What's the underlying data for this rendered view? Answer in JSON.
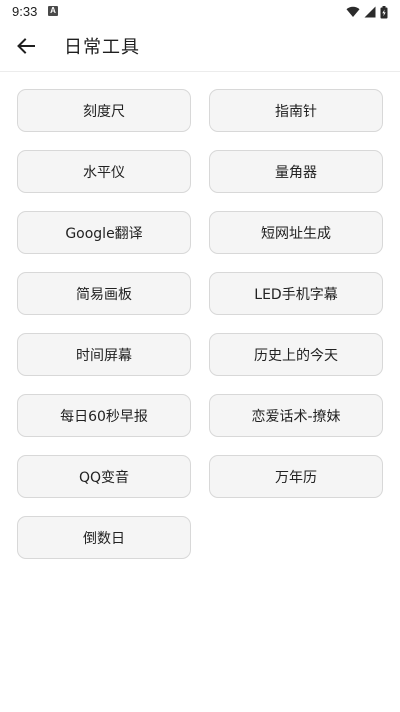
{
  "status_bar": {
    "time": "9:33",
    "notification_icon": "a-icon",
    "right_icons": [
      "wifi-icon",
      "signal-icon",
      "battery-icon"
    ]
  },
  "app_bar": {
    "back_icon": "arrow-left-icon",
    "title": "日常工具"
  },
  "tools": [
    "刻度尺",
    "指南针",
    "水平仪",
    "量角器",
    "Google翻译",
    "短网址生成",
    "简易画板",
    "LED手机字幕",
    "时间屏幕",
    "历史上的今天",
    "每日60秒早报",
    "恋爱话术-撩妹",
    "QQ变音",
    "万年历",
    "倒数日"
  ],
  "colors": {
    "button_bg": "#f5f5f5",
    "button_border": "#d8d8d8",
    "text": "#1f1f1f",
    "background": "#ffffff"
  }
}
